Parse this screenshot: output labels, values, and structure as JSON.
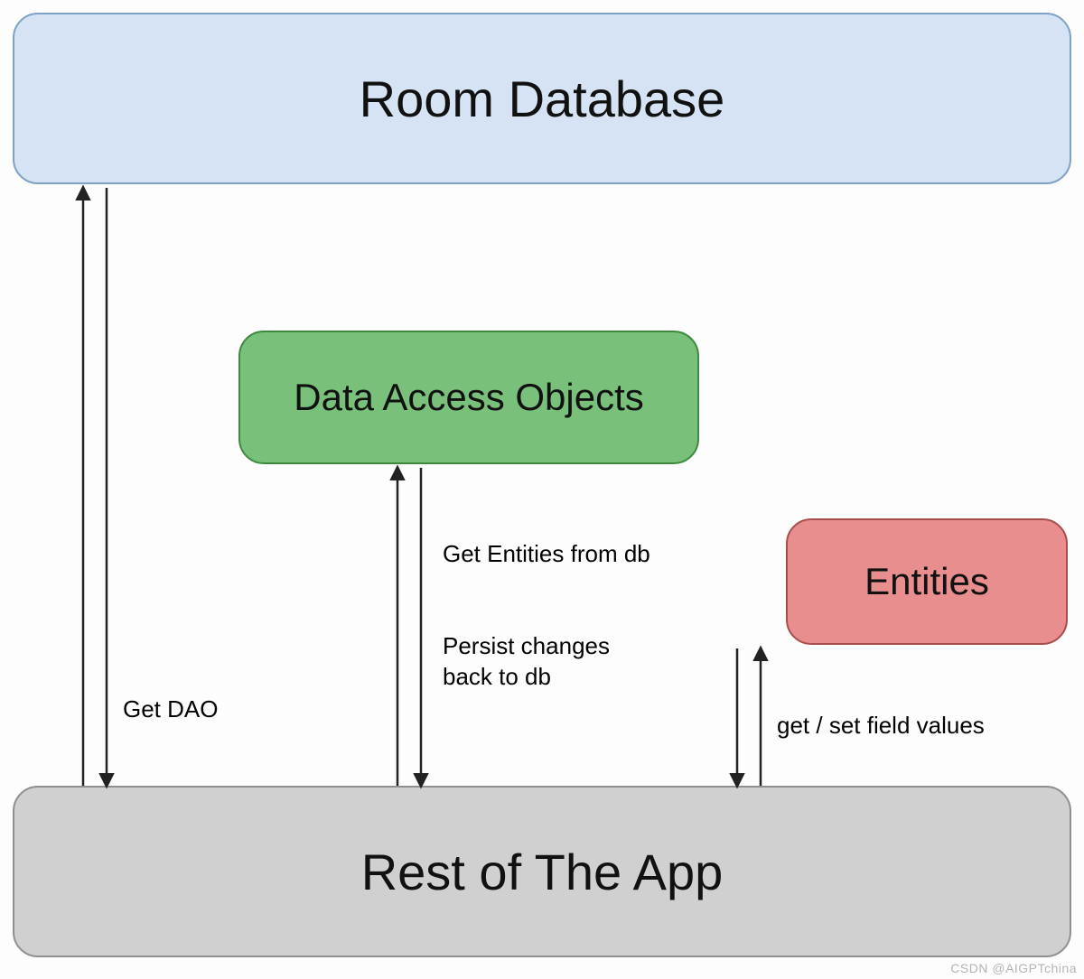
{
  "boxes": {
    "room": "Room Database",
    "dao": "Data Access Objects",
    "entities": "Entities",
    "app": "Rest of The App"
  },
  "labels": {
    "get_dao": "Get DAO",
    "get_entities": "Get Entities from db",
    "persist_line1": "Persist changes",
    "persist_line2": "back to db",
    "get_set": "get / set field values"
  },
  "colors": {
    "room_fill": "#d5e3f4",
    "dao_fill": "#79c17a",
    "entities_fill": "#e98e8e",
    "app_fill": "#d0d0d0",
    "arrow": "#222"
  },
  "watermark": "CSDN @AIGPTchina"
}
